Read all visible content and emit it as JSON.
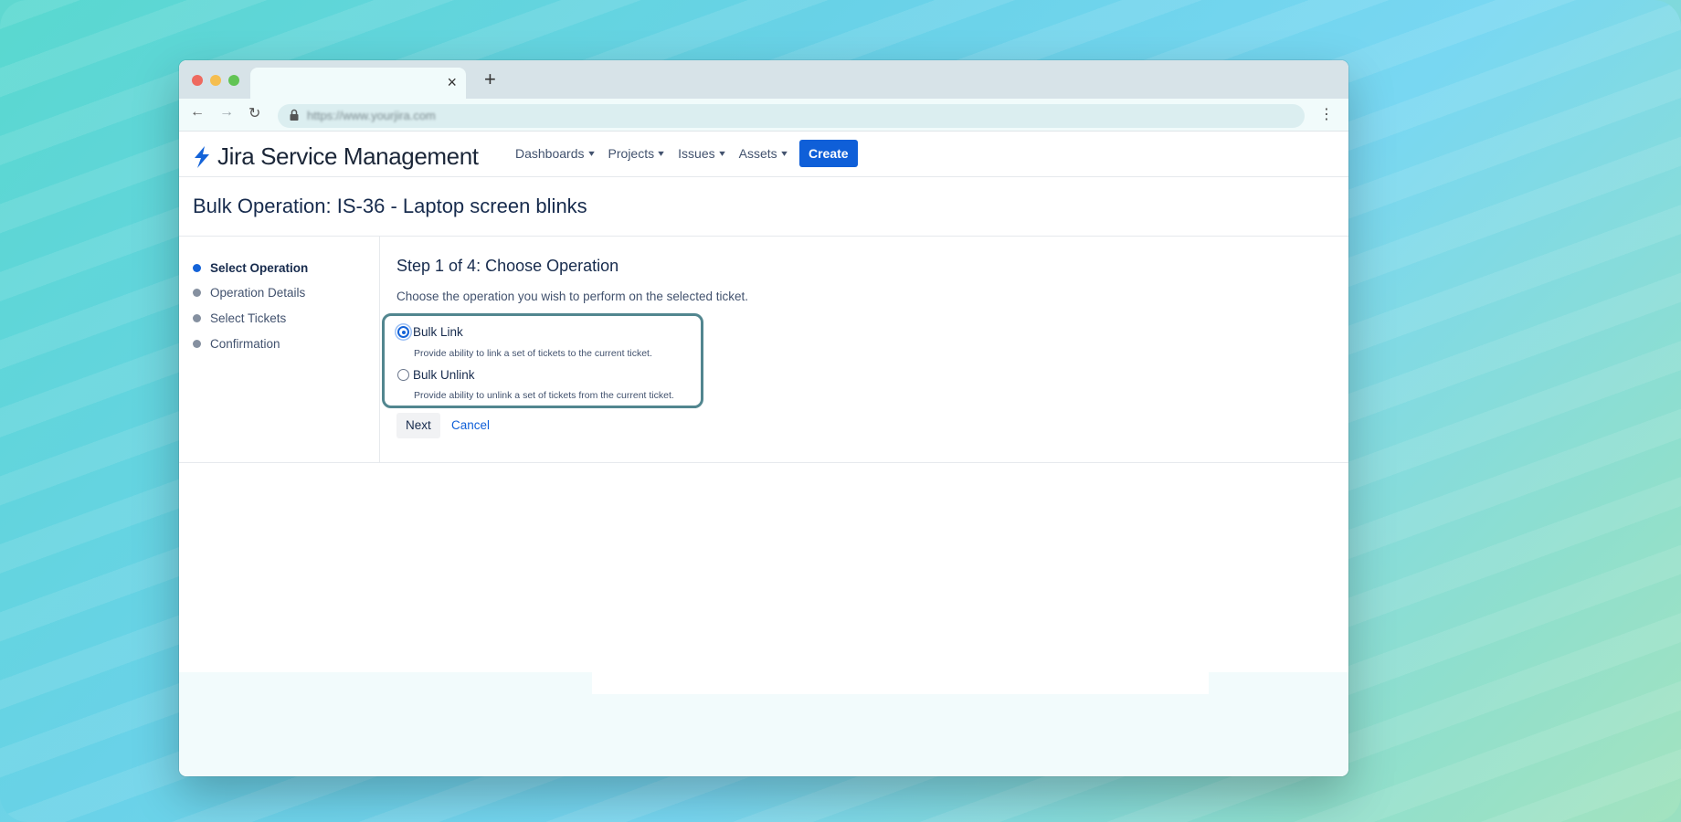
{
  "browser": {
    "url": "https://www.yourjira.com",
    "close_glyph": "×",
    "newtab_glyph": "+",
    "back_glyph": "←",
    "forward_glyph": "→",
    "reload_glyph": "↻",
    "menu_glyph": "⋮"
  },
  "header": {
    "product_name": "Jira Service Management",
    "nav": [
      {
        "label": "Dashboards"
      },
      {
        "label": "Projects"
      },
      {
        "label": "Issues"
      },
      {
        "label": "Assets"
      }
    ],
    "chevron": "⌄",
    "create_label": "Create",
    "accent_color": "#0f5fd8"
  },
  "page": {
    "title": "Bulk Operation: IS-36 - Laptop screen blinks"
  },
  "steps": [
    {
      "label": "Select Operation",
      "active": true
    },
    {
      "label": "Operation Details",
      "active": false
    },
    {
      "label": "Select Tickets",
      "active": false
    },
    {
      "label": "Confirmation",
      "active": false
    }
  ],
  "main": {
    "step_title": "Step 1 of 4: Choose Operation",
    "step_description": "Choose the operation you wish to perform on the selected ticket.",
    "options": [
      {
        "label": "Bulk Link",
        "help": "Provide ability to link a set of tickets to the current ticket.",
        "checked": true
      },
      {
        "label": "Bulk Unlink",
        "help": "Provide ability to unlink a set of tickets from the current ticket.",
        "checked": false
      }
    ],
    "next_label": "Next",
    "cancel_label": "Cancel"
  }
}
